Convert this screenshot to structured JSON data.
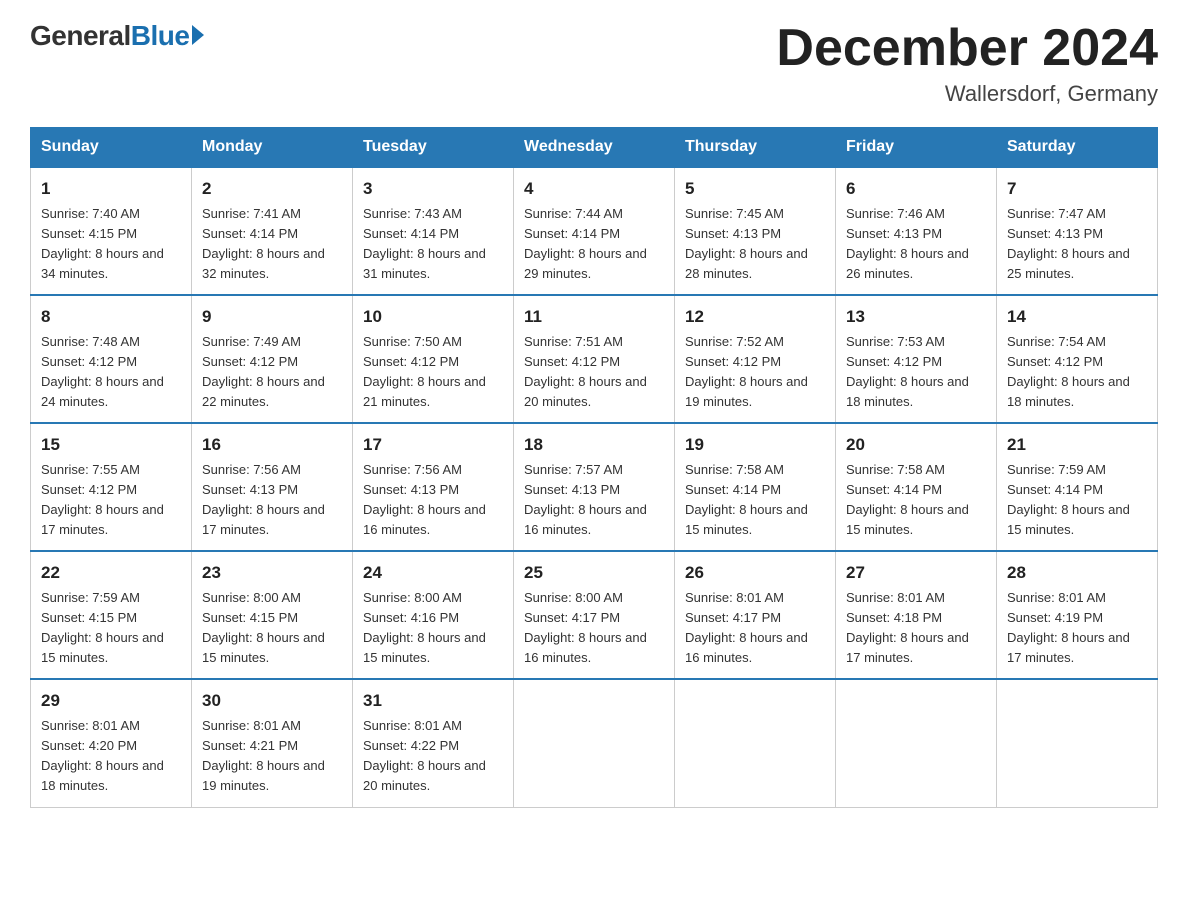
{
  "header": {
    "logo": {
      "general": "General",
      "blue": "Blue"
    },
    "title": "December 2024",
    "location": "Wallersdorf, Germany"
  },
  "columns": [
    "Sunday",
    "Monday",
    "Tuesday",
    "Wednesday",
    "Thursday",
    "Friday",
    "Saturday"
  ],
  "weeks": [
    [
      {
        "day": "1",
        "sunrise": "Sunrise: 7:40 AM",
        "sunset": "Sunset: 4:15 PM",
        "daylight": "Daylight: 8 hours and 34 minutes."
      },
      {
        "day": "2",
        "sunrise": "Sunrise: 7:41 AM",
        "sunset": "Sunset: 4:14 PM",
        "daylight": "Daylight: 8 hours and 32 minutes."
      },
      {
        "day": "3",
        "sunrise": "Sunrise: 7:43 AM",
        "sunset": "Sunset: 4:14 PM",
        "daylight": "Daylight: 8 hours and 31 minutes."
      },
      {
        "day": "4",
        "sunrise": "Sunrise: 7:44 AM",
        "sunset": "Sunset: 4:14 PM",
        "daylight": "Daylight: 8 hours and 29 minutes."
      },
      {
        "day": "5",
        "sunrise": "Sunrise: 7:45 AM",
        "sunset": "Sunset: 4:13 PM",
        "daylight": "Daylight: 8 hours and 28 minutes."
      },
      {
        "day": "6",
        "sunrise": "Sunrise: 7:46 AM",
        "sunset": "Sunset: 4:13 PM",
        "daylight": "Daylight: 8 hours and 26 minutes."
      },
      {
        "day": "7",
        "sunrise": "Sunrise: 7:47 AM",
        "sunset": "Sunset: 4:13 PM",
        "daylight": "Daylight: 8 hours and 25 minutes."
      }
    ],
    [
      {
        "day": "8",
        "sunrise": "Sunrise: 7:48 AM",
        "sunset": "Sunset: 4:12 PM",
        "daylight": "Daylight: 8 hours and 24 minutes."
      },
      {
        "day": "9",
        "sunrise": "Sunrise: 7:49 AM",
        "sunset": "Sunset: 4:12 PM",
        "daylight": "Daylight: 8 hours and 22 minutes."
      },
      {
        "day": "10",
        "sunrise": "Sunrise: 7:50 AM",
        "sunset": "Sunset: 4:12 PM",
        "daylight": "Daylight: 8 hours and 21 minutes."
      },
      {
        "day": "11",
        "sunrise": "Sunrise: 7:51 AM",
        "sunset": "Sunset: 4:12 PM",
        "daylight": "Daylight: 8 hours and 20 minutes."
      },
      {
        "day": "12",
        "sunrise": "Sunrise: 7:52 AM",
        "sunset": "Sunset: 4:12 PM",
        "daylight": "Daylight: 8 hours and 19 minutes."
      },
      {
        "day": "13",
        "sunrise": "Sunrise: 7:53 AM",
        "sunset": "Sunset: 4:12 PM",
        "daylight": "Daylight: 8 hours and 18 minutes."
      },
      {
        "day": "14",
        "sunrise": "Sunrise: 7:54 AM",
        "sunset": "Sunset: 4:12 PM",
        "daylight": "Daylight: 8 hours and 18 minutes."
      }
    ],
    [
      {
        "day": "15",
        "sunrise": "Sunrise: 7:55 AM",
        "sunset": "Sunset: 4:12 PM",
        "daylight": "Daylight: 8 hours and 17 minutes."
      },
      {
        "day": "16",
        "sunrise": "Sunrise: 7:56 AM",
        "sunset": "Sunset: 4:13 PM",
        "daylight": "Daylight: 8 hours and 17 minutes."
      },
      {
        "day": "17",
        "sunrise": "Sunrise: 7:56 AM",
        "sunset": "Sunset: 4:13 PM",
        "daylight": "Daylight: 8 hours and 16 minutes."
      },
      {
        "day": "18",
        "sunrise": "Sunrise: 7:57 AM",
        "sunset": "Sunset: 4:13 PM",
        "daylight": "Daylight: 8 hours and 16 minutes."
      },
      {
        "day": "19",
        "sunrise": "Sunrise: 7:58 AM",
        "sunset": "Sunset: 4:14 PM",
        "daylight": "Daylight: 8 hours and 15 minutes."
      },
      {
        "day": "20",
        "sunrise": "Sunrise: 7:58 AM",
        "sunset": "Sunset: 4:14 PM",
        "daylight": "Daylight: 8 hours and 15 minutes."
      },
      {
        "day": "21",
        "sunrise": "Sunrise: 7:59 AM",
        "sunset": "Sunset: 4:14 PM",
        "daylight": "Daylight: 8 hours and 15 minutes."
      }
    ],
    [
      {
        "day": "22",
        "sunrise": "Sunrise: 7:59 AM",
        "sunset": "Sunset: 4:15 PM",
        "daylight": "Daylight: 8 hours and 15 minutes."
      },
      {
        "day": "23",
        "sunrise": "Sunrise: 8:00 AM",
        "sunset": "Sunset: 4:15 PM",
        "daylight": "Daylight: 8 hours and 15 minutes."
      },
      {
        "day": "24",
        "sunrise": "Sunrise: 8:00 AM",
        "sunset": "Sunset: 4:16 PM",
        "daylight": "Daylight: 8 hours and 15 minutes."
      },
      {
        "day": "25",
        "sunrise": "Sunrise: 8:00 AM",
        "sunset": "Sunset: 4:17 PM",
        "daylight": "Daylight: 8 hours and 16 minutes."
      },
      {
        "day": "26",
        "sunrise": "Sunrise: 8:01 AM",
        "sunset": "Sunset: 4:17 PM",
        "daylight": "Daylight: 8 hours and 16 minutes."
      },
      {
        "day": "27",
        "sunrise": "Sunrise: 8:01 AM",
        "sunset": "Sunset: 4:18 PM",
        "daylight": "Daylight: 8 hours and 17 minutes."
      },
      {
        "day": "28",
        "sunrise": "Sunrise: 8:01 AM",
        "sunset": "Sunset: 4:19 PM",
        "daylight": "Daylight: 8 hours and 17 minutes."
      }
    ],
    [
      {
        "day": "29",
        "sunrise": "Sunrise: 8:01 AM",
        "sunset": "Sunset: 4:20 PM",
        "daylight": "Daylight: 8 hours and 18 minutes."
      },
      {
        "day": "30",
        "sunrise": "Sunrise: 8:01 AM",
        "sunset": "Sunset: 4:21 PM",
        "daylight": "Daylight: 8 hours and 19 minutes."
      },
      {
        "day": "31",
        "sunrise": "Sunrise: 8:01 AM",
        "sunset": "Sunset: 4:22 PM",
        "daylight": "Daylight: 8 hours and 20 minutes."
      },
      null,
      null,
      null,
      null
    ]
  ]
}
